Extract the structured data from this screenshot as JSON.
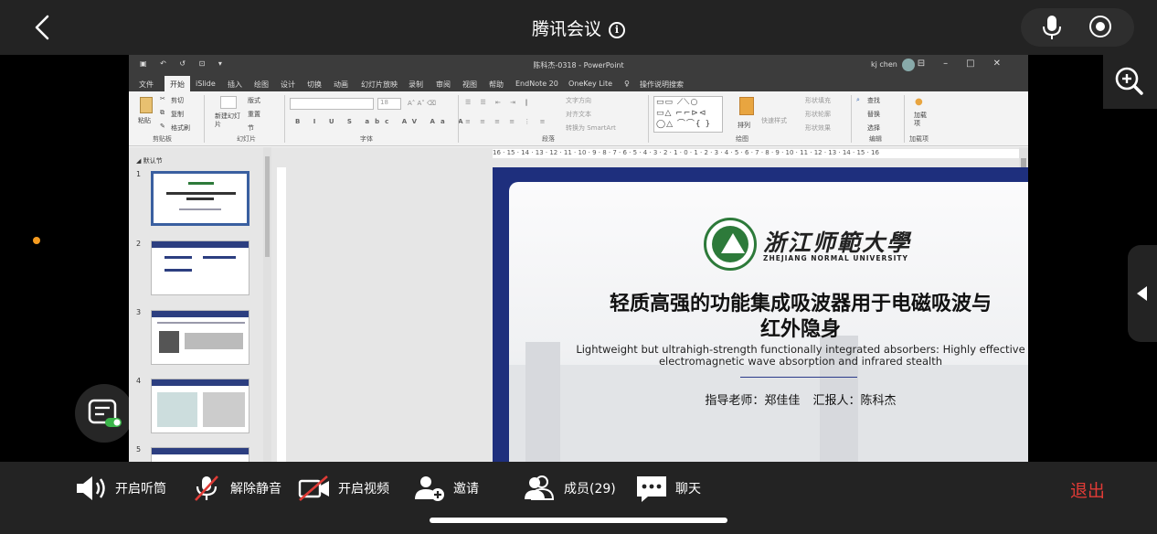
{
  "meeting": {
    "title": "腾讯会议",
    "exit_label": "退出"
  },
  "toolbar": {
    "speaker": "开启听筒",
    "unmute": "解除静音",
    "video": "开启视频",
    "invite": "邀请",
    "members": "成员(29)",
    "chat": "聊天"
  },
  "powerpoint": {
    "window_title": "陈科杰-0318 - PowerPoint",
    "user": "kj chen",
    "tabs": [
      "文件",
      "开始",
      "iSlide",
      "插入",
      "绘图",
      "设计",
      "切换",
      "动画",
      "幻灯片放映",
      "录制",
      "审阅",
      "视图",
      "帮助",
      "EndNote 20",
      "OneKey Lite",
      "操作说明搜索"
    ],
    "active_tab": "开始",
    "ribbon": {
      "paste": "粘贴",
      "cut": "剪切",
      "copy": "复制",
      "format_painter": "格式刷",
      "clipboard": "剪贴板",
      "new_slide": "新建幻灯片",
      "layout": "版式",
      "reset": "重置",
      "section": "节",
      "slides": "幻灯片",
      "font_size": "18",
      "font": "字体",
      "text_direction": "文字方向",
      "align_text": "对齐文本",
      "smartart": "转换为 SmartArt",
      "paragraph": "段落",
      "arrange": "排列",
      "quick_styles": "快速样式",
      "shape_fill": "形状填充",
      "shape_outline": "形状轮廓",
      "shape_effects": "形状效果",
      "drawing": "绘图",
      "find": "查找",
      "replace": "替换",
      "select": "选择",
      "editing": "编辑",
      "addin": "加载项",
      "addin_group": "加载项"
    },
    "section_name": "默认节",
    "slide_numbers": [
      "1",
      "2",
      "3",
      "4",
      "5"
    ],
    "ruler": "16 · 15 · 14 · 13 · 12 · 11 · 10 · 9 · 8 · 7 · 6 · 5 · 4 · 3 · 2 · 1 · 0 · 1 · 2 · 3 · 4 · 5 · 6 · 7 · 8 · 9 · 10 · 11 · 12 · 13 · 14 · 15 · 16"
  },
  "slide": {
    "university_cn": "浙江师範大學",
    "university_en": "ZHEJIANG NORMAL UNIVERSITY",
    "title_line1": "轻质高强的功能集成吸波器用于电磁吸波与",
    "title_line2": "红外隐身",
    "subtitle_line1": "Lightweight but ultrahigh-strength functionally integrated absorbers: Highly effective",
    "subtitle_line2": "electromagnetic wave absorption and infrared stealth",
    "presenter": "指导老师：郑佳佳    汇报人：陈科杰"
  },
  "colors": {
    "accent_red": "#e03b36",
    "slide_blue": "#1e2f7d",
    "logo_green": "#2d7a3a"
  }
}
